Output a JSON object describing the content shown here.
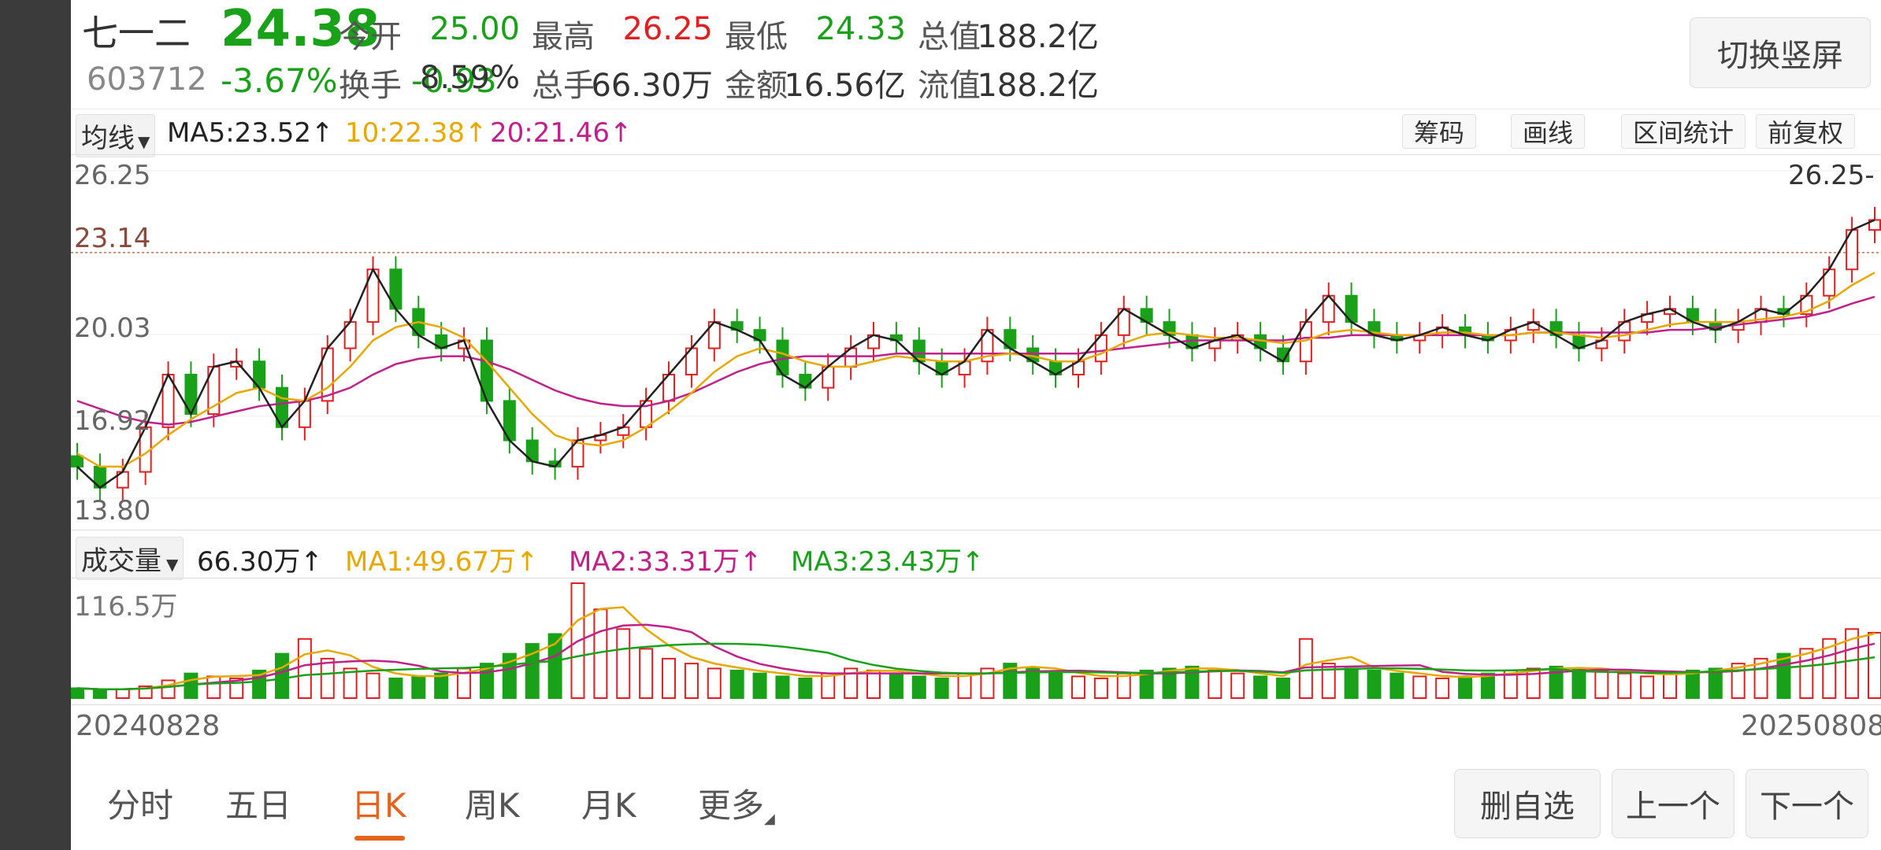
{
  "stock": {
    "name": "七一二",
    "code": "603712",
    "price": "24.38",
    "change_pct": "-3.67%",
    "change": "-0.93"
  },
  "quotes": [
    {
      "label": "今开",
      "value": "25.00",
      "color": "#1aa11a"
    },
    {
      "label": "最高",
      "value": "26.25",
      "color": "#e02020"
    },
    {
      "label": "最低",
      "value": "24.33",
      "color": "#1aa11a"
    },
    {
      "label": "总值",
      "value": "188.2亿",
      "color": "#333333"
    },
    {
      "label": "换手",
      "value": "8.59%",
      "color": "#333333"
    },
    {
      "label": "总手",
      "value": "66.30万",
      "color": "#333333"
    },
    {
      "label": "金额",
      "value": "16.56亿",
      "color": "#333333"
    },
    {
      "label": "流值",
      "value": "188.2亿",
      "color": "#333333"
    }
  ],
  "switch_label": "切换竖屏",
  "ma_row": {
    "dropdown": "均线",
    "ma5": "MA5:23.52↑",
    "ma10": "10:22.38↑",
    "ma20": "20:21.46↑",
    "tools": [
      "筹码",
      "画线",
      "区间统计",
      "前复权"
    ]
  },
  "volume_row": {
    "dropdown": "成交量",
    "vol": "66.30万↑",
    "ma1": "MA1:49.67万↑",
    "ma2": "MA2:33.31万↑",
    "ma3": "MA3:23.43万↑"
  },
  "colors": {
    "up": "#e02020",
    "down": "#1aa11a",
    "ma5": "#222222",
    "ma10": "#e8a800",
    "ma20": "#c0208a",
    "accent": "#e8621a",
    "buy_marker": "#f26a5a",
    "sell_marker": "#3d8ee6",
    "t_marker": "#f5a623"
  },
  "chart_data": {
    "type": "candlestick",
    "y_axis_labels": [
      "26.25",
      "23.14",
      "20.03",
      "16.92",
      "13.80"
    ],
    "ylim": [
      13.8,
      26.25
    ],
    "reference_line": 23.14,
    "high_label": "26.25",
    "low_label": "13.80",
    "start_date": "20240828",
    "end_date": "20250808",
    "volume_max_label": "116.5万",
    "close_trend": [
      15.0,
      14.2,
      14.8,
      16.5,
      18.5,
      17.0,
      18.8,
      19.0,
      18.0,
      16.5,
      17.5,
      19.5,
      20.5,
      22.5,
      21.0,
      20.0,
      19.5,
      19.8,
      17.5,
      16.0,
      15.2,
      15.0,
      16.0,
      16.2,
      16.5,
      17.5,
      18.5,
      19.5,
      20.5,
      20.2,
      19.8,
      18.5,
      18.0,
      18.8,
      19.5,
      20.0,
      19.8,
      19.0,
      18.5,
      19.0,
      20.2,
      19.5,
      19.0,
      18.5,
      19.0,
      20.0,
      21.0,
      20.5,
      20.0,
      19.5,
      19.8,
      20.0,
      19.5,
      19.0,
      20.5,
      21.5,
      20.5,
      20.0,
      19.8,
      20.0,
      20.3,
      20.0,
      19.8,
      20.2,
      20.5,
      20.0,
      19.5,
      19.8,
      20.5,
      20.8,
      21.0,
      20.5,
      20.2,
      20.5,
      21.0,
      20.8,
      21.5,
      22.5,
      24.0,
      24.38
    ],
    "ma10_trend": [
      15.5,
      15.0,
      15.0,
      15.5,
      16.2,
      16.8,
      17.3,
      17.8,
      18.0,
      17.6,
      17.5,
      18.0,
      18.8,
      19.8,
      20.3,
      20.5,
      20.3,
      19.9,
      19.0,
      18.0,
      17.0,
      16.2,
      15.9,
      15.8,
      16.0,
      16.5,
      17.1,
      17.8,
      18.6,
      19.2,
      19.5,
      19.3,
      19.0,
      18.8,
      18.8,
      19.0,
      19.2,
      19.1,
      19.0,
      19.0,
      19.2,
      19.3,
      19.2,
      19.0,
      19.0,
      19.3,
      19.7,
      20.0,
      20.1,
      20.0,
      19.9,
      19.9,
      19.8,
      19.7,
      19.8,
      20.1,
      20.2,
      20.1,
      20.0,
      20.0,
      20.1,
      20.1,
      20.0,
      20.0,
      20.1,
      20.1,
      20.0,
      19.9,
      20.0,
      20.2,
      20.4,
      20.5,
      20.5,
      20.5,
      20.6,
      20.7,
      20.9,
      21.3,
      21.9,
      22.38
    ],
    "ma20_trend": [
      17.5,
      17.2,
      16.9,
      16.7,
      16.6,
      16.7,
      16.9,
      17.1,
      17.3,
      17.4,
      17.5,
      17.7,
      18.0,
      18.5,
      18.9,
      19.1,
      19.2,
      19.2,
      19.0,
      18.7,
      18.3,
      17.9,
      17.6,
      17.4,
      17.3,
      17.3,
      17.5,
      17.8,
      18.2,
      18.6,
      18.9,
      19.1,
      19.2,
      19.2,
      19.2,
      19.2,
      19.3,
      19.3,
      19.3,
      19.3,
      19.3,
      19.3,
      19.3,
      19.3,
      19.3,
      19.4,
      19.5,
      19.6,
      19.7,
      19.8,
      19.8,
      19.8,
      19.8,
      19.8,
      19.9,
      19.9,
      20.0,
      20.0,
      20.0,
      20.0,
      20.0,
      20.0,
      20.0,
      20.0,
      20.1,
      20.1,
      20.1,
      20.1,
      20.1,
      20.1,
      20.2,
      20.2,
      20.3,
      20.4,
      20.5,
      20.6,
      20.7,
      20.9,
      21.2,
      21.46
    ],
    "volume_trend": [
      10,
      8,
      9,
      12,
      18,
      25,
      22,
      20,
      28,
      45,
      60,
      40,
      30,
      25,
      20,
      22,
      25,
      30,
      35,
      45,
      55,
      65,
      116.5,
      90,
      70,
      50,
      40,
      35,
      30,
      28,
      25,
      22,
      20,
      25,
      30,
      28,
      25,
      22,
      20,
      25,
      30,
      35,
      30,
      25,
      22,
      20,
      25,
      28,
      30,
      32,
      28,
      25,
      22,
      20,
      60,
      35,
      30,
      28,
      25,
      22,
      20,
      22,
      25,
      28,
      30,
      32,
      30,
      28,
      25,
      22,
      25,
      28,
      30,
      35,
      40,
      45,
      50,
      60,
      70,
      66.3
    ]
  },
  "dates": {
    "start": "20240828",
    "end": "20250808"
  },
  "tabs": [
    {
      "label": "分时",
      "active": false
    },
    {
      "label": "五日",
      "active": false
    },
    {
      "label": "日K",
      "active": true
    },
    {
      "label": "周K",
      "active": false
    },
    {
      "label": "月K",
      "active": false
    },
    {
      "label": "更多",
      "active": false
    }
  ],
  "bottom_buttons": [
    "删自选",
    "上一个",
    "下一个"
  ]
}
